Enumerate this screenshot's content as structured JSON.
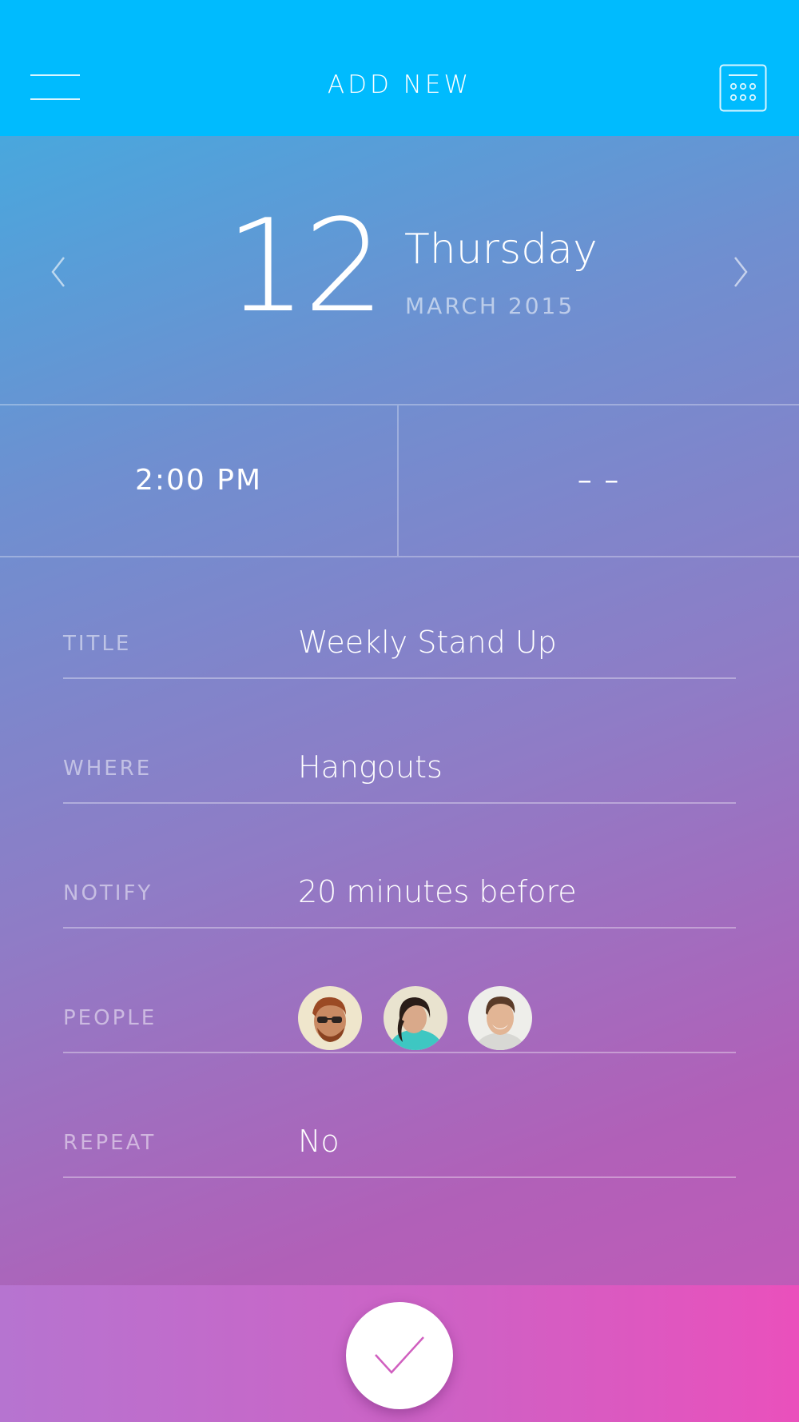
{
  "header": {
    "title": "ADD NEW",
    "menu_icon": "hamburger-menu-icon",
    "calendar_icon": "calendar-grid-icon",
    "background": "#00bbfe"
  },
  "date": {
    "day": "12",
    "weekday": "Thursday",
    "month_year": "MARCH 2015",
    "prev_icon": "chevron-left-icon",
    "next_icon": "chevron-right-icon"
  },
  "time": {
    "start": "2:00 PM",
    "end": "– –"
  },
  "form": {
    "title": {
      "label": "TITLE",
      "value": "Weekly Stand Up"
    },
    "where": {
      "label": "WHERE",
      "value": "Hangouts"
    },
    "notify": {
      "label": "NOTIFY",
      "value": "20 minutes before"
    },
    "people": {
      "label": "PEOPLE",
      "avatars": [
        "person-1-avatar",
        "person-2-avatar",
        "person-3-avatar"
      ]
    },
    "repeat": {
      "label": "REPEAT",
      "value": "No"
    }
  },
  "footer": {
    "confirm_icon": "checkmark-icon",
    "accent": "#ea50bc"
  }
}
